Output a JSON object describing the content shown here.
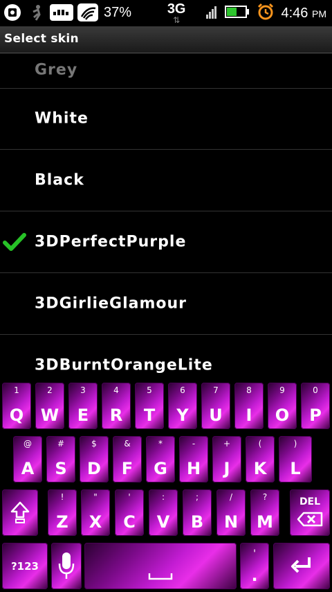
{
  "status_bar": {
    "icons": [
      "privacy-lock-icon",
      "runner-icon",
      "wireless-icon",
      "signal-wave-icon"
    ],
    "battery_percent": "37%",
    "network": "3G",
    "time": "4:46",
    "ampm": "PM"
  },
  "header": {
    "title": "Select skin"
  },
  "skin_list": {
    "partial_item": "Grey",
    "items": [
      {
        "label": "White",
        "selected": false
      },
      {
        "label": "Black",
        "selected": false
      },
      {
        "label": "3DPerfectPurple",
        "selected": true
      },
      {
        "label": "3DGirlieGlamour",
        "selected": false
      },
      {
        "label": "3DBurntOrangeLite",
        "selected": false
      }
    ]
  },
  "keyboard": {
    "row1": [
      {
        "main": "Q",
        "sup": "1"
      },
      {
        "main": "W",
        "sup": "2"
      },
      {
        "main": "E",
        "sup": "3"
      },
      {
        "main": "R",
        "sup": "4"
      },
      {
        "main": "T",
        "sup": "5"
      },
      {
        "main": "Y",
        "sup": "6"
      },
      {
        "main": "U",
        "sup": "7"
      },
      {
        "main": "I",
        "sup": "8"
      },
      {
        "main": "O",
        "sup": "9"
      },
      {
        "main": "P",
        "sup": "0"
      }
    ],
    "row2": [
      {
        "main": "A",
        "sup": "@"
      },
      {
        "main": "S",
        "sup": "#"
      },
      {
        "main": "D",
        "sup": "$"
      },
      {
        "main": "F",
        "sup": "&"
      },
      {
        "main": "G",
        "sup": "*"
      },
      {
        "main": "H",
        "sup": "-"
      },
      {
        "main": "J",
        "sup": "+"
      },
      {
        "main": "K",
        "sup": "("
      },
      {
        "main": "L",
        "sup": ")"
      }
    ],
    "row3": [
      {
        "main": "Z",
        "sup": "!"
      },
      {
        "main": "X",
        "sup": "\""
      },
      {
        "main": "C",
        "sup": "'"
      },
      {
        "main": "V",
        "sup": ":"
      },
      {
        "main": "B",
        "sup": ";"
      },
      {
        "main": "N",
        "sup": "/"
      },
      {
        "main": "M",
        "sup": "?"
      }
    ],
    "del_label": "DEL",
    "symbols_label": "?123",
    "period_sup": "'",
    "period_main": ".",
    "accent_color": "#c21cd2"
  }
}
